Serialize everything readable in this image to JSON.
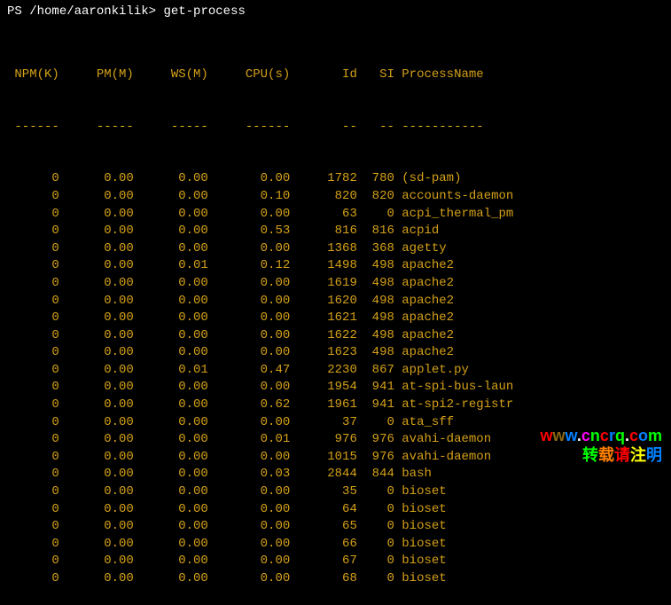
{
  "prompt": {
    "prefix": "PS ",
    "path": "/home/aaronkilik",
    "gt": "> ",
    "command": "get-process"
  },
  "headers": {
    "npm": "NPM(K)",
    "pm": "PM(M)",
    "ws": "WS(M)",
    "cpu": "CPU(s)",
    "id": "Id",
    "si": "SI",
    "name": "ProcessName"
  },
  "separator": {
    "npm": "------",
    "pm": "-----",
    "ws": "-----",
    "cpu": "------",
    "id": "--",
    "si": "--",
    "name": "-----------"
  },
  "rows": [
    {
      "npm": "0",
      "pm": "0.00",
      "ws": "0.00",
      "cpu": "0.00",
      "id": "1782",
      "si": "780",
      "name": "(sd-pam)"
    },
    {
      "npm": "0",
      "pm": "0.00",
      "ws": "0.00",
      "cpu": "0.10",
      "id": "820",
      "si": "820",
      "name": "accounts-daemon"
    },
    {
      "npm": "0",
      "pm": "0.00",
      "ws": "0.00",
      "cpu": "0.00",
      "id": "63",
      "si": "0",
      "name": "acpi_thermal_pm"
    },
    {
      "npm": "0",
      "pm": "0.00",
      "ws": "0.00",
      "cpu": "0.53",
      "id": "816",
      "si": "816",
      "name": "acpid"
    },
    {
      "npm": "0",
      "pm": "0.00",
      "ws": "0.00",
      "cpu": "0.00",
      "id": "1368",
      "si": "368",
      "name": "agetty"
    },
    {
      "npm": "0",
      "pm": "0.00",
      "ws": "0.01",
      "cpu": "0.12",
      "id": "1498",
      "si": "498",
      "name": "apache2"
    },
    {
      "npm": "0",
      "pm": "0.00",
      "ws": "0.00",
      "cpu": "0.00",
      "id": "1619",
      "si": "498",
      "name": "apache2"
    },
    {
      "npm": "0",
      "pm": "0.00",
      "ws": "0.00",
      "cpu": "0.00",
      "id": "1620",
      "si": "498",
      "name": "apache2"
    },
    {
      "npm": "0",
      "pm": "0.00",
      "ws": "0.00",
      "cpu": "0.00",
      "id": "1621",
      "si": "498",
      "name": "apache2"
    },
    {
      "npm": "0",
      "pm": "0.00",
      "ws": "0.00",
      "cpu": "0.00",
      "id": "1622",
      "si": "498",
      "name": "apache2"
    },
    {
      "npm": "0",
      "pm": "0.00",
      "ws": "0.00",
      "cpu": "0.00",
      "id": "1623",
      "si": "498",
      "name": "apache2"
    },
    {
      "npm": "0",
      "pm": "0.00",
      "ws": "0.01",
      "cpu": "0.47",
      "id": "2230",
      "si": "867",
      "name": "applet.py"
    },
    {
      "npm": "0",
      "pm": "0.00",
      "ws": "0.00",
      "cpu": "0.00",
      "id": "1954",
      "si": "941",
      "name": "at-spi-bus-laun"
    },
    {
      "npm": "0",
      "pm": "0.00",
      "ws": "0.00",
      "cpu": "0.62",
      "id": "1961",
      "si": "941",
      "name": "at-spi2-registr"
    },
    {
      "npm": "0",
      "pm": "0.00",
      "ws": "0.00",
      "cpu": "0.00",
      "id": "37",
      "si": "0",
      "name": "ata_sff"
    },
    {
      "npm": "0",
      "pm": "0.00",
      "ws": "0.00",
      "cpu": "0.01",
      "id": "976",
      "si": "976",
      "name": "avahi-daemon"
    },
    {
      "npm": "0",
      "pm": "0.00",
      "ws": "0.00",
      "cpu": "0.00",
      "id": "1015",
      "si": "976",
      "name": "avahi-daemon"
    },
    {
      "npm": "0",
      "pm": "0.00",
      "ws": "0.00",
      "cpu": "0.03",
      "id": "2844",
      "si": "844",
      "name": "bash"
    },
    {
      "npm": "0",
      "pm": "0.00",
      "ws": "0.00",
      "cpu": "0.00",
      "id": "35",
      "si": "0",
      "name": "bioset"
    },
    {
      "npm": "0",
      "pm": "0.00",
      "ws": "0.00",
      "cpu": "0.00",
      "id": "64",
      "si": "0",
      "name": "bioset"
    },
    {
      "npm": "0",
      "pm": "0.00",
      "ws": "0.00",
      "cpu": "0.00",
      "id": "65",
      "si": "0",
      "name": "bioset"
    },
    {
      "npm": "0",
      "pm": "0.00",
      "ws": "0.00",
      "cpu": "0.00",
      "id": "66",
      "si": "0",
      "name": "bioset"
    },
    {
      "npm": "0",
      "pm": "0.00",
      "ws": "0.00",
      "cpu": "0.00",
      "id": "67",
      "si": "0",
      "name": "bioset"
    },
    {
      "npm": "0",
      "pm": "0.00",
      "ws": "0.00",
      "cpu": "0.00",
      "id": "68",
      "si": "0",
      "name": "bioset"
    }
  ],
  "watermark": {
    "url_prefix": "www.",
    "url_main": "cncrq",
    "url_suffix": ".com",
    "subtitle": "转载请注明"
  }
}
